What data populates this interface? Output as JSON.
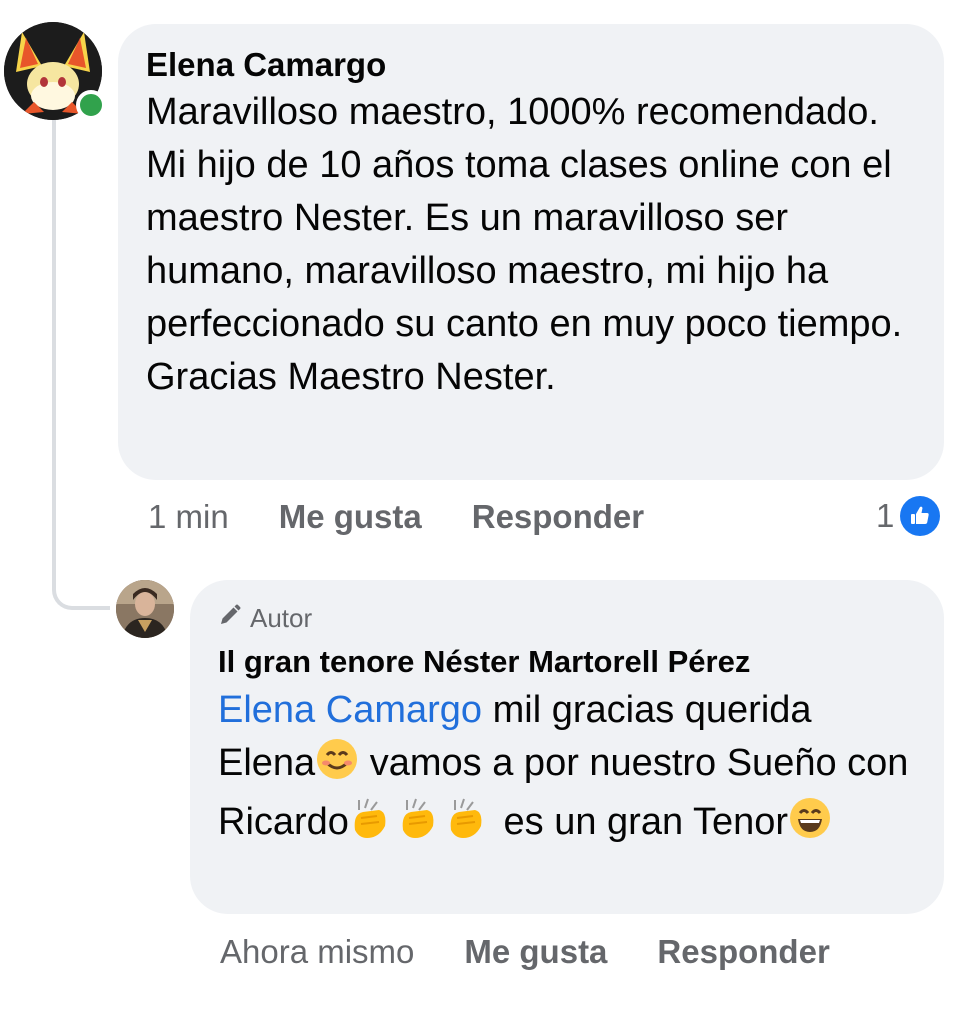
{
  "comment": {
    "author": "Elena Camargo",
    "text": "Maravilloso maestro, 1000% recomendado. Mi hijo de 10 años toma clases online con el maestro Nester. Es un maravilloso ser humano, maravilloso maestro, mi hijo ha perfeccionado su canto en muy poco tiempo. Gracias Maestro Nester.",
    "time": "1 min",
    "like_label": "Me gusta",
    "reply_label": "Responder",
    "reaction_count": "1",
    "reaction_icon": "thumbs-up-icon",
    "online_status_color": "#31a24c"
  },
  "reply": {
    "badge_icon": "pencil-icon",
    "badge_label": "Autor",
    "author": "Il gran tenore Néster Martorell Pérez",
    "mention": "Elena Camargo",
    "text_1": " mil gracias querida Elena",
    "text_2": " vamos a por nuestro Sueño con Ricardo",
    "text_3": " es un gran Tenor",
    "emojis": [
      "smiling-face-icon",
      "clapping-hands-icon",
      "clapping-hands-icon",
      "clapping-hands-icon",
      "grinning-face-icon"
    ],
    "time": "Ahora mismo",
    "like_label": "Me gusta",
    "reply_label": "Responder"
  },
  "colors": {
    "bubble": "#f0f2f5",
    "mention": "#216fdb",
    "secondary_text": "#65676b",
    "like_blue": "#1877f2"
  }
}
